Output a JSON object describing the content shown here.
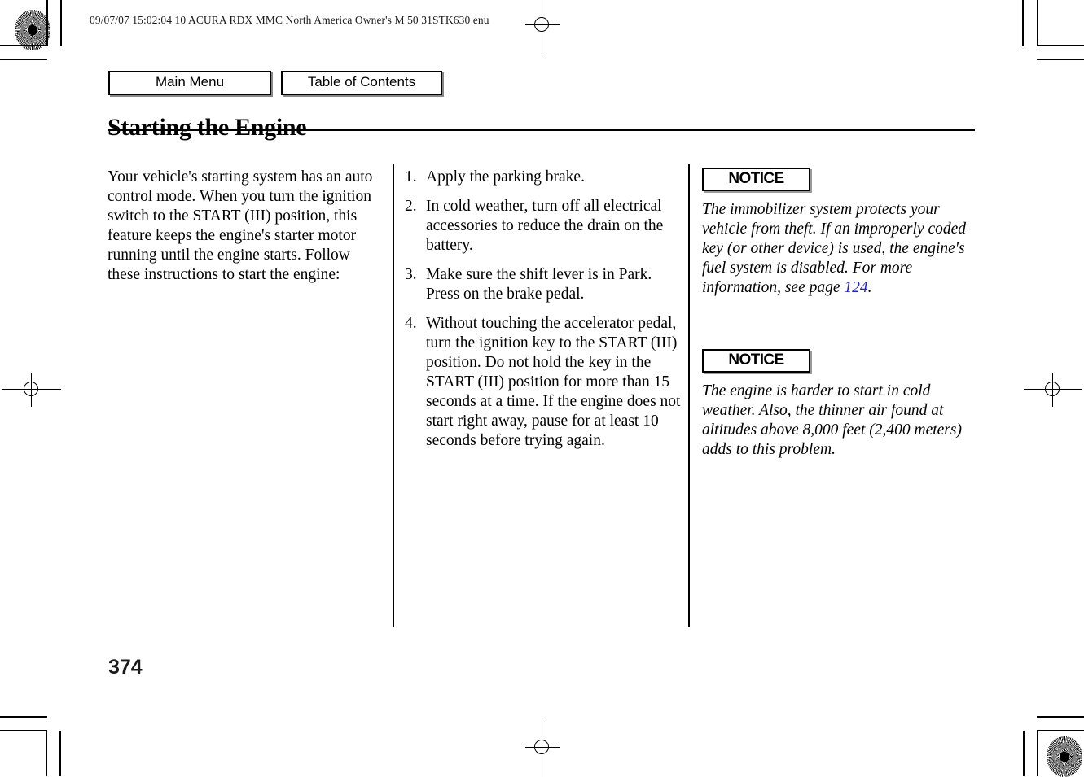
{
  "header": {
    "slug": "09/07/07 15:02:04    10 ACURA RDX MMC North America Owner's M 50 31STK630 enu"
  },
  "nav": {
    "main_menu_label": "Main Menu",
    "table_of_contents_label": "Table of Contents"
  },
  "title": "Starting the Engine",
  "columns": {
    "left": {
      "paragraph": "Your vehicle's starting system has an auto control mode. When you turn the ignition switch to the START (III) position, this feature keeps the engine's starter motor running until the engine starts. Follow these instructions to start the engine:"
    },
    "middle": {
      "steps": [
        {
          "number": "1.",
          "text": "Apply the parking brake."
        },
        {
          "number": "2.",
          "text": "In cold weather, turn off all electrical accessories to reduce the drain on the battery."
        },
        {
          "number": "3.",
          "text": "Make sure the shift lever is in Park. Press on the brake pedal."
        },
        {
          "number": "4.",
          "text": "Without touching the accelerator pedal, turn the ignition key to the START (III) position. Do not hold the key in the START (III) position for more than 15 seconds at a time. If the engine does not start right away, pause for at least 10 seconds before trying again."
        }
      ]
    },
    "right": {
      "notices": [
        {
          "badge": "NOTICE",
          "text_before": "The immobilizer system protects your vehicle from theft. If an improperly coded key (or other device) is used, the engine's fuel system is disabled. For more information, see page ",
          "page_link": "124",
          "text_after": "."
        },
        {
          "badge": "NOTICE",
          "text_before": "The engine is harder to start in cold weather. Also, the thinner air found at altitudes above 8,000 feet (2,400 meters) adds to this problem.",
          "page_link": "",
          "text_after": ""
        }
      ]
    }
  },
  "page_number": "374",
  "colors": {
    "ink": "#000000",
    "page_link": "#2222cc",
    "paper": "#ffffff"
  }
}
